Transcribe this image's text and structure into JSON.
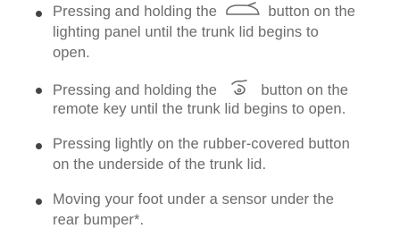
{
  "items": [
    {
      "line1_a": "Pressing and holding the ",
      "line1_icon": "trunk-open-icon",
      "line1_b": " button on the",
      "line2": "lighting panel until the trunk lid begins to",
      "line3": "open."
    },
    {
      "line1_a": "Pressing and holding the ",
      "line1_icon": "remote-trunk-icon",
      "line1_b": " button on the",
      "line2": "remote key until the trunk lid begins to open."
    },
    {
      "line1": "Pressing lightly on the rubber-covered button",
      "line2": "on the underside of the trunk lid."
    },
    {
      "line1": "Moving your foot under a sensor under the",
      "line2": "rear bumper*."
    }
  ]
}
